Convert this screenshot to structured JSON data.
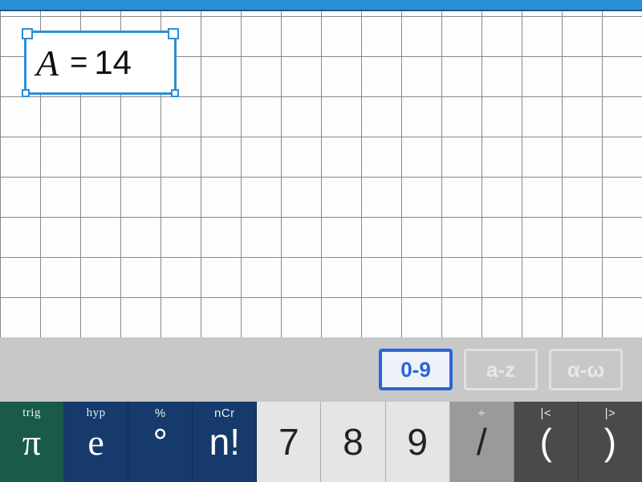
{
  "canvas": {
    "selection": {
      "variable": "A",
      "operator": "=",
      "value": "14"
    }
  },
  "mode_tabs": {
    "numeric": "0-9",
    "latin": "a-z",
    "greek": "α-ω"
  },
  "keys": {
    "pi": {
      "main": "π",
      "sup": "trig"
    },
    "e": {
      "main": "e",
      "sup": "hyp"
    },
    "deg": {
      "main": "°",
      "sup": "%"
    },
    "fact": {
      "main": "n!",
      "sup": "nCr"
    },
    "seven": {
      "main": "7",
      "sup": ""
    },
    "eight": {
      "main": "8",
      "sup": ""
    },
    "nine": {
      "main": "9",
      "sup": ""
    },
    "div": {
      "main": "/",
      "sup": "÷"
    },
    "lpar": {
      "main": "(",
      "sup": "|<"
    },
    "rpar": {
      "main": ")",
      "sup": "|>"
    }
  }
}
